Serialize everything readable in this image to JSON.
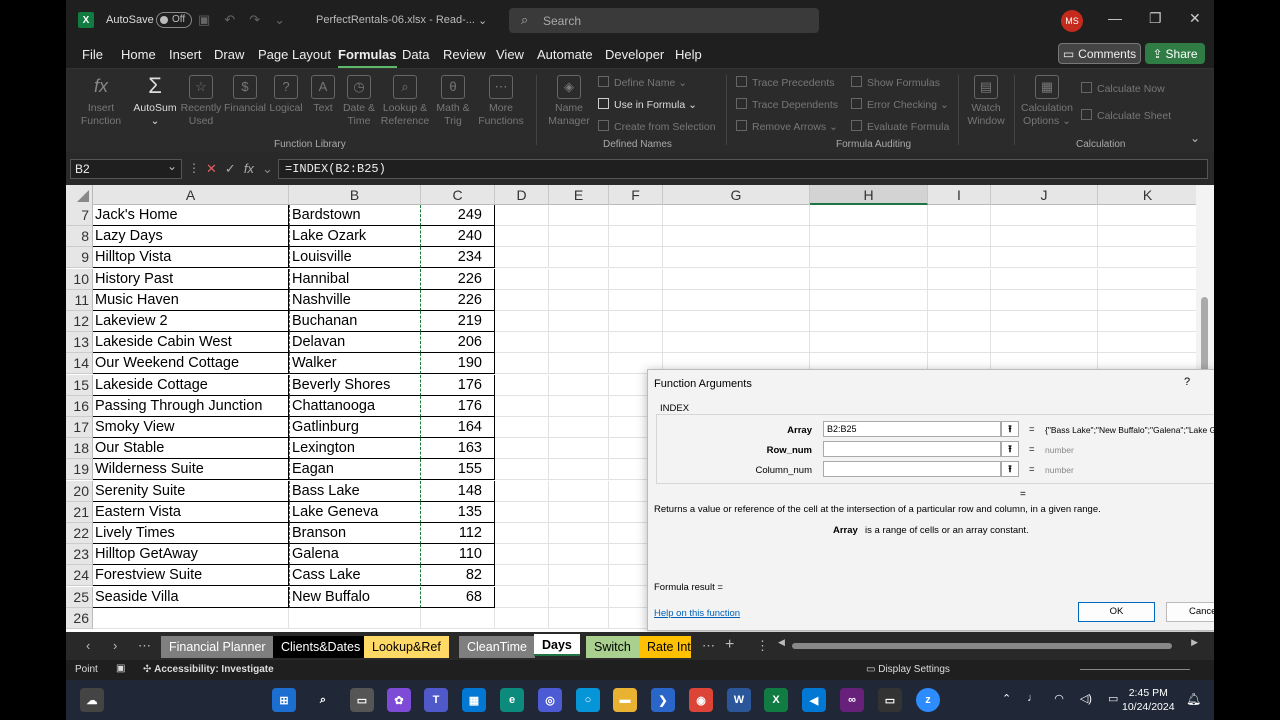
{
  "titlebar": {
    "autosave_label": "AutoSave",
    "autosave_state": "Off",
    "filename": "PerfectRentals-06.xlsx  -  Read-...",
    "search_placeholder": "Search",
    "user_initials": "MS"
  },
  "menu": {
    "items": [
      "File",
      "Home",
      "Insert",
      "Draw",
      "Page Layout",
      "Formulas",
      "Data",
      "Review",
      "View",
      "Automate",
      "Developer",
      "Help"
    ],
    "active": "Formulas",
    "comments_label": "Comments",
    "share_label": "Share"
  },
  "ribbon": {
    "insert_function": "Insert Function",
    "autosum": "AutoSum",
    "recently_used": "Recently Used",
    "financial": "Financial",
    "logical": "Logical",
    "text": "Text",
    "date_time": "Date & Time",
    "lookup_ref": "Lookup & Reference",
    "math_trig": "Math & Trig",
    "more_functions": "More Functions",
    "group_function_library": "Function Library",
    "name_manager": "Name Manager",
    "define_name": "Define Name",
    "use_in_formula": "Use in Formula",
    "create_from_selection": "Create from Selection",
    "group_defined_names": "Defined Names",
    "trace_precedents": "Trace Precedents",
    "trace_dependents": "Trace Dependents",
    "remove_arrows": "Remove Arrows",
    "show_formulas": "Show Formulas",
    "error_checking": "Error Checking",
    "evaluate_formula": "Evaluate Formula",
    "watch_window": "Watch Window",
    "group_formula_auditing": "Formula Auditing",
    "calculation_options": "Calculation Options",
    "calculate_now": "Calculate Now",
    "calculate_sheet": "Calculate Sheet",
    "group_calculation": "Calculation"
  },
  "formula_bar": {
    "name_box": "B2",
    "formula": "=INDEX(B2:B25)"
  },
  "columns": [
    "A",
    "B",
    "C",
    "D",
    "E",
    "F",
    "G",
    "H",
    "I",
    "J",
    "K"
  ],
  "active_column": "H",
  "rows": [
    {
      "n": "7",
      "a": "Jack's Home",
      "b": "Bardstown",
      "c": "249"
    },
    {
      "n": "8",
      "a": "Lazy Days",
      "b": "Lake Ozark",
      "c": "240"
    },
    {
      "n": "9",
      "a": "Hilltop Vista",
      "b": "Louisville",
      "c": "234"
    },
    {
      "n": "10",
      "a": "History Past",
      "b": "Hannibal",
      "c": "226"
    },
    {
      "n": "11",
      "a": "Music Haven",
      "b": "Nashville",
      "c": "226"
    },
    {
      "n": "12",
      "a": "Lakeview 2",
      "b": "Buchanan",
      "c": "219"
    },
    {
      "n": "13",
      "a": "Lakeside Cabin West",
      "b": "Delavan",
      "c": "206"
    },
    {
      "n": "14",
      "a": "Our Weekend Cottage",
      "b": "Walker",
      "c": "190"
    },
    {
      "n": "15",
      "a": "Lakeside Cottage",
      "b": "Beverly Shores",
      "c": "176"
    },
    {
      "n": "16",
      "a": "Passing Through Junction",
      "b": "Chattanooga",
      "c": "176"
    },
    {
      "n": "17",
      "a": "Smoky View",
      "b": "Gatlinburg",
      "c": "164"
    },
    {
      "n": "18",
      "a": "Our Stable",
      "b": "Lexington",
      "c": "163"
    },
    {
      "n": "19",
      "a": "Wilderness Suite",
      "b": "Eagan",
      "c": "155"
    },
    {
      "n": "20",
      "a": "Serenity Suite",
      "b": "Bass Lake",
      "c": "148"
    },
    {
      "n": "21",
      "a": "Eastern Vista",
      "b": "Lake Geneva",
      "c": "135"
    },
    {
      "n": "22",
      "a": "Lively Times",
      "b": "Branson",
      "c": "112"
    },
    {
      "n": "23",
      "a": "Hilltop GetAway",
      "b": "Galena",
      "c": "110"
    },
    {
      "n": "24",
      "a": "Forestview Suite",
      "b": "Cass Lake",
      "c": "82"
    },
    {
      "n": "25",
      "a": "Seaside Villa",
      "b": "New Buffalo",
      "c": "68"
    },
    {
      "n": "26",
      "a": "",
      "b": "",
      "c": ""
    }
  ],
  "dialog": {
    "title": "Function Arguments",
    "help": "?",
    "function_name": "INDEX",
    "args": [
      {
        "label": "Array",
        "value": "B2:B25",
        "result": "{\"Bass Lake\";\"New Buffalo\";\"Galena\";\"Lake Ge"
      },
      {
        "label": "Row_num",
        "value": "",
        "result": "number"
      },
      {
        "label": "Column_num",
        "value": "",
        "result": "number"
      }
    ],
    "result_eq": "=",
    "description": "Returns a value or reference of the cell at the intersection of a particular row and column, in a given range.",
    "arg_name": "Array",
    "arg_description": "is a range of cells or an array constant.",
    "formula_result": "Formula result =",
    "help_link": "Help on this function",
    "ok": "OK",
    "cancel": "Cancel"
  },
  "sheet_tabs": [
    {
      "name": "Financial Planner",
      "bg": "#7f7f7f",
      "fg": "#ffffff"
    },
    {
      "name": "Clients&Dates",
      "bg": "#000000",
      "fg": "#ffffff"
    },
    {
      "name": "Lookup&Ref",
      "bg": "#ffd966",
      "fg": "#000000"
    },
    {
      "name": "CleanTime",
      "bg": "#7f7f7f",
      "fg": "#ffffff"
    },
    {
      "name": "Days",
      "bg": "#ffffff",
      "fg": "#000000"
    },
    {
      "name": "Switch",
      "bg": "#a9d08e",
      "fg": "#000000"
    },
    {
      "name": "Rate Int",
      "bg": "#ffc000",
      "fg": "#000000"
    }
  ],
  "active_sheet": "Days",
  "statusbar": {
    "mode": "Point",
    "accessibility": "Accessibility: Investigate",
    "display_settings": "Display Settings"
  },
  "taskbar": {
    "time": "2:45 PM",
    "date": "10/24/2024"
  }
}
